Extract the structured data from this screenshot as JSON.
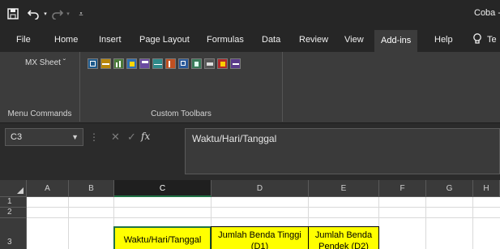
{
  "titlebar": {
    "document_title": "Coba -",
    "icons": [
      "save-icon",
      "undo-icon",
      "undo-dropdown-icon",
      "redo-icon",
      "redo-dropdown-icon",
      "customize-qat-icon"
    ]
  },
  "tabs": [
    {
      "label": "File"
    },
    {
      "label": "Home"
    },
    {
      "label": "Insert"
    },
    {
      "label": "Page Layout"
    },
    {
      "label": "Formulas"
    },
    {
      "label": "Data"
    },
    {
      "label": "Review"
    },
    {
      "label": "View"
    },
    {
      "label": "Add-ins",
      "active": true
    },
    {
      "label": "Help"
    },
    {
      "label": "Te"
    }
  ],
  "tell_me_icon": "lightbulb-icon",
  "ribbon": {
    "menu_group": {
      "button_label": "MX Sheet ˇ",
      "group_label": "Menu Commands"
    },
    "toolbar_group": {
      "group_label": "Custom Toolbars",
      "icon_count": 12
    }
  },
  "formula_bar": {
    "name_box": "C3",
    "formula": "Waktu/Hari/Tanggal",
    "fx_label": "fx",
    "icons": [
      "more-options-icon",
      "cancel-icon",
      "enter-icon",
      "insert-function-icon"
    ]
  },
  "sheet": {
    "columns": [
      "A",
      "B",
      "C",
      "D",
      "E",
      "F",
      "G",
      "H"
    ],
    "selected_column": "C",
    "rows": [
      "1",
      "2",
      "3"
    ],
    "cells": {
      "C3": "Waktu/Hari/Tanggal",
      "D3": "Jumlah Benda Tinggi (D1)",
      "E3": "Jumlah Benda Pendek (D2)"
    }
  },
  "colors": {
    "highlight_fill": "#ffff00",
    "selection_border": "#217346",
    "dark_bg": "#262626",
    "ribbon_bg": "#3c3c3c"
  }
}
